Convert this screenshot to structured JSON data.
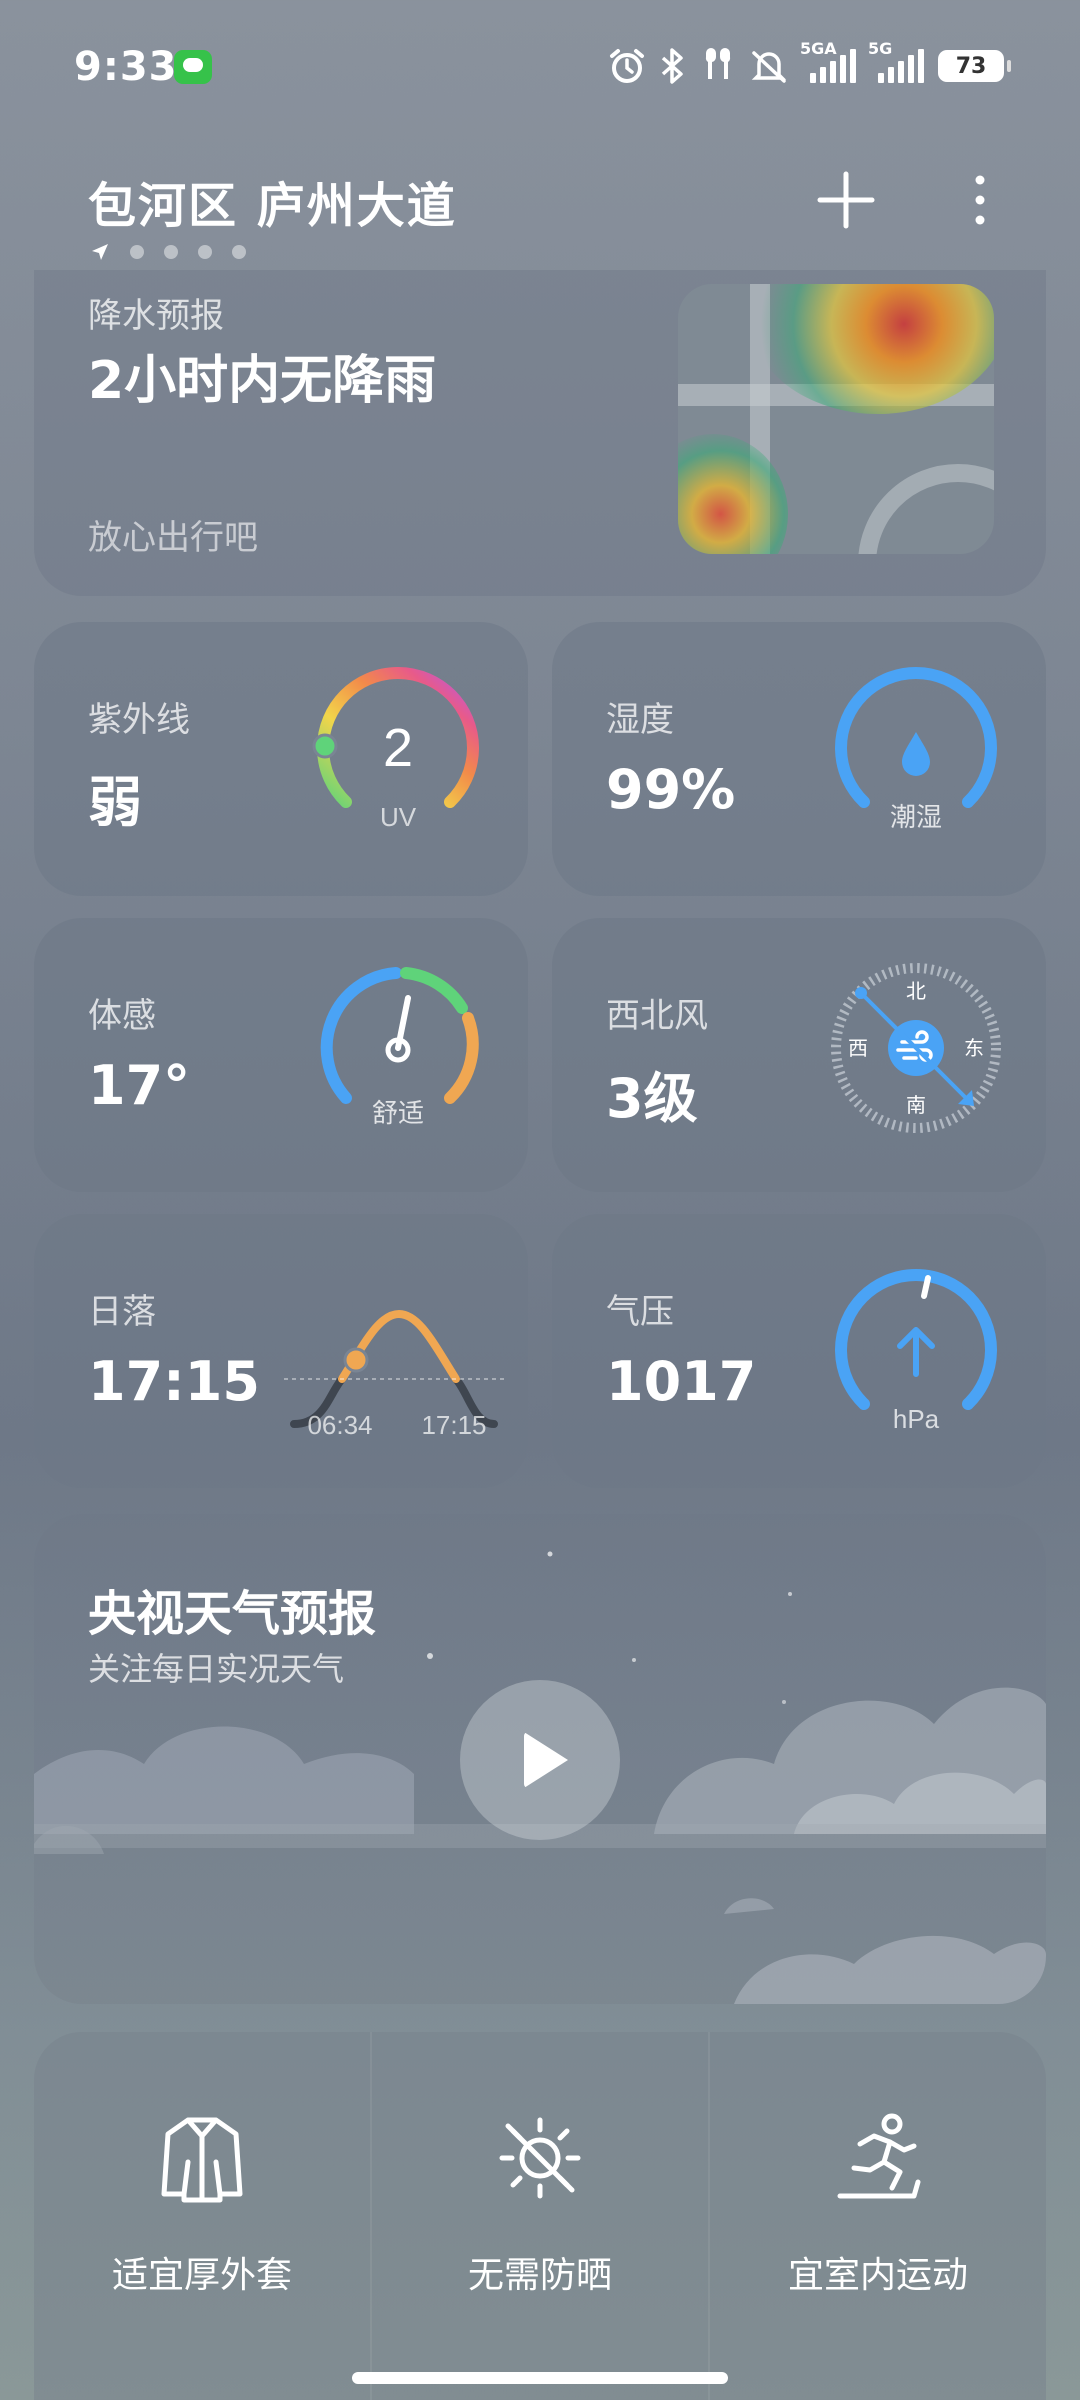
{
  "status_bar": {
    "time": "9:33",
    "signal1_label": "5GA",
    "signal2_label": "5G",
    "battery": "73"
  },
  "header": {
    "location": "包河区 庐州大道",
    "page_count": 4
  },
  "precipitation": {
    "title": "降水预报",
    "main": "2小时内无降雨",
    "sub": "放心出行吧"
  },
  "uv": {
    "label": "紫外线",
    "value": "弱",
    "gauge_value": "2",
    "gauge_unit": "UV"
  },
  "humidity": {
    "label": "湿度",
    "value": "99%",
    "gauge_text": "潮湿",
    "level": 0.99
  },
  "feels_like": {
    "label": "体感",
    "value": "17°",
    "gauge_text": "舒适"
  },
  "wind": {
    "label": "西北风",
    "value": "3级",
    "north": "北",
    "south": "南",
    "west": "西",
    "east": "东"
  },
  "sunset": {
    "label": "日落",
    "value": "17:15",
    "sunrise_time": "06:34",
    "sunset_time": "17:15"
  },
  "pressure": {
    "label": "气压",
    "value": "1017",
    "unit": "hPa"
  },
  "video": {
    "title": "央视天气预报",
    "subtitle": "关注每日实况天气"
  },
  "tips": [
    {
      "label": "适宜厚外套",
      "icon": "coat-icon"
    },
    {
      "label": "无需防晒",
      "icon": "no-sunscreen-icon"
    },
    {
      "label": "宜室内运动",
      "icon": "indoor-exercise-icon"
    }
  ],
  "colors": {
    "accent_blue": "#4aa3f5",
    "comfort_orange": "#f0a752",
    "good_green": "#5fd37a"
  }
}
